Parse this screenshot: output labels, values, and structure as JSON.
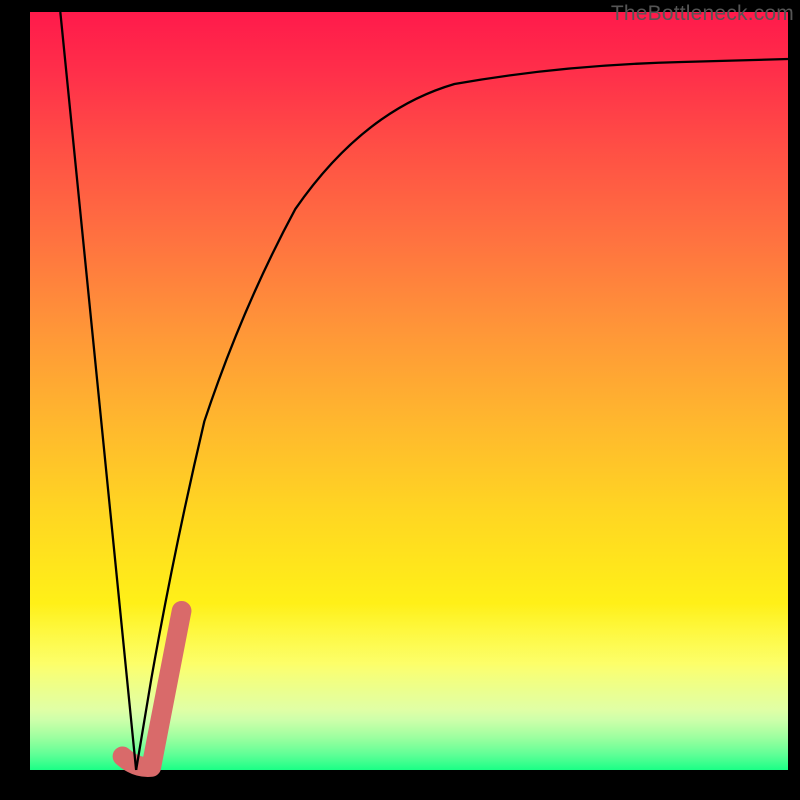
{
  "watermark": "TheBottleneck.com",
  "chart_data": {
    "type": "line",
    "title": "",
    "xlabel": "",
    "ylabel": "",
    "x_range": [
      0,
      1000
    ],
    "y_range": [
      0,
      1000
    ],
    "grid": false,
    "series": [
      {
        "name": "bottleneck-curve-left",
        "stroke": "#000000",
        "width": 3,
        "points": [
          {
            "x": 40,
            "y": 1000
          },
          {
            "x": 140,
            "y": 0
          }
        ]
      },
      {
        "name": "bottleneck-curve-right",
        "stroke": "#000000",
        "width": 3,
        "points": [
          {
            "x": 140,
            "y": 0
          },
          {
            "x": 160,
            "y": 120
          },
          {
            "x": 190,
            "y": 290
          },
          {
            "x": 230,
            "y": 460
          },
          {
            "x": 280,
            "y": 610
          },
          {
            "x": 350,
            "y": 740
          },
          {
            "x": 440,
            "y": 830
          },
          {
            "x": 560,
            "y": 885
          },
          {
            "x": 700,
            "y": 915
          },
          {
            "x": 860,
            "y": 930
          },
          {
            "x": 1000,
            "y": 938
          }
        ]
      },
      {
        "name": "highlight-segment",
        "stroke": "#d96a6a",
        "width": 26,
        "linecap": "round",
        "points": [
          {
            "x": 122,
            "y": 18
          },
          {
            "x": 140,
            "y": 6
          },
          {
            "x": 160,
            "y": 6
          },
          {
            "x": 200,
            "y": 210
          }
        ]
      }
    ],
    "background_gradient": [
      "#ff1a4b",
      "#ff2f4a",
      "#ff4f45",
      "#ff7240",
      "#ff9638",
      "#ffb72e",
      "#ffd622",
      "#fff018",
      "#fcff3d",
      "#d2ff79",
      "#4bff8a",
      "#1aff86"
    ]
  }
}
